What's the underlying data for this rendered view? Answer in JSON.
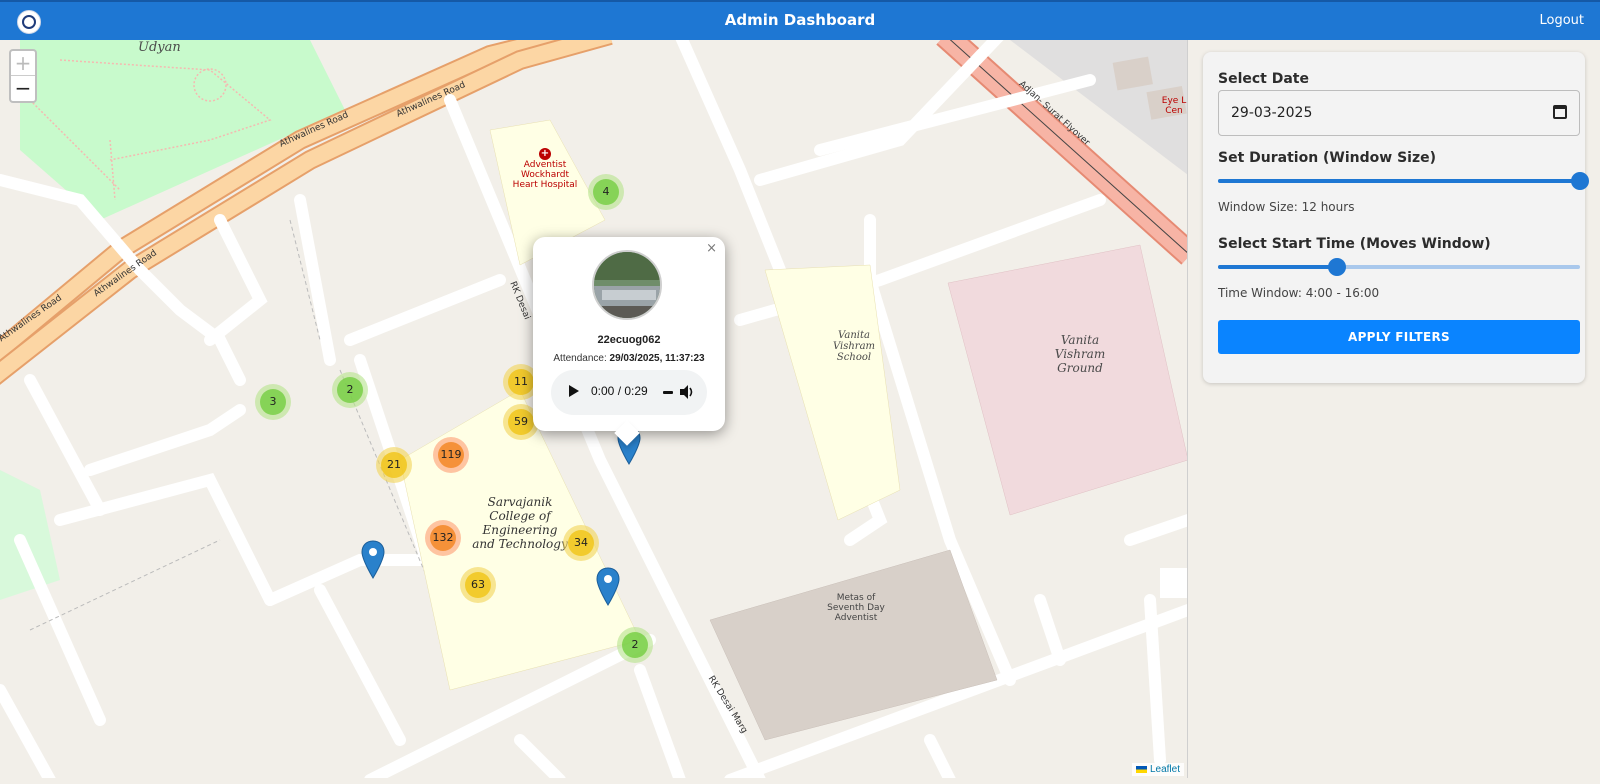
{
  "header": {
    "title": "Admin Dashboard",
    "logout_label": "Logout"
  },
  "map": {
    "zoom_in": "+",
    "zoom_out": "−",
    "attribution": "Leaflet",
    "labels": {
      "udyan": "Udyan",
      "athwalines_1": "Athwalines Road",
      "athwalines_2": "Athwalines Road",
      "athwalines_3": "Athwalines Road",
      "athwalines_4": "Athwalines Road",
      "rk_desai_1": "RK Desai",
      "rk_desai_2": "RK Desai Marg",
      "flyover": "Adjan- Surat Flyover",
      "hospital": "Adventist Wockhardt Heart Hospital",
      "vanita_school": "Vanita Vishram School",
      "vanita_ground": "Vanita Vishram Ground",
      "college": "Sarvajanik College of Engineering and Technology",
      "metas": "Metas of Seventh Day Adventist",
      "eye": "Eye L Cen"
    },
    "clusters": [
      {
        "count": "4",
        "size": "small"
      },
      {
        "count": "2",
        "size": "small"
      },
      {
        "count": "3",
        "size": "small"
      },
      {
        "count": "11",
        "size": "med"
      },
      {
        "count": "59",
        "size": "med"
      },
      {
        "count": "21",
        "size": "med"
      },
      {
        "count": "119",
        "size": "large"
      },
      {
        "count": "132",
        "size": "large"
      },
      {
        "count": "34",
        "size": "med"
      },
      {
        "count": "63",
        "size": "med"
      },
      {
        "count": "2",
        "size": "small"
      }
    ],
    "popup": {
      "close": "×",
      "user_id": "22ecuog062",
      "attendance_label": "Attendance:",
      "attendance_value": "29/03/2025, 11:37:23",
      "audio_time": "0:00 / 0:29"
    }
  },
  "filters": {
    "date_label": "Select Date",
    "date_value": "29-03-2025",
    "duration_label": "Set Duration (Window Size)",
    "duration_fraction": 1.0,
    "window_size_text": "Window Size: 12 hours",
    "start_label": "Select Start Time (Moves Window)",
    "start_fraction": 0.33,
    "time_window_text": "Time Window: 4:00 - 16:00",
    "apply_label": "APPLY FILTERS"
  }
}
